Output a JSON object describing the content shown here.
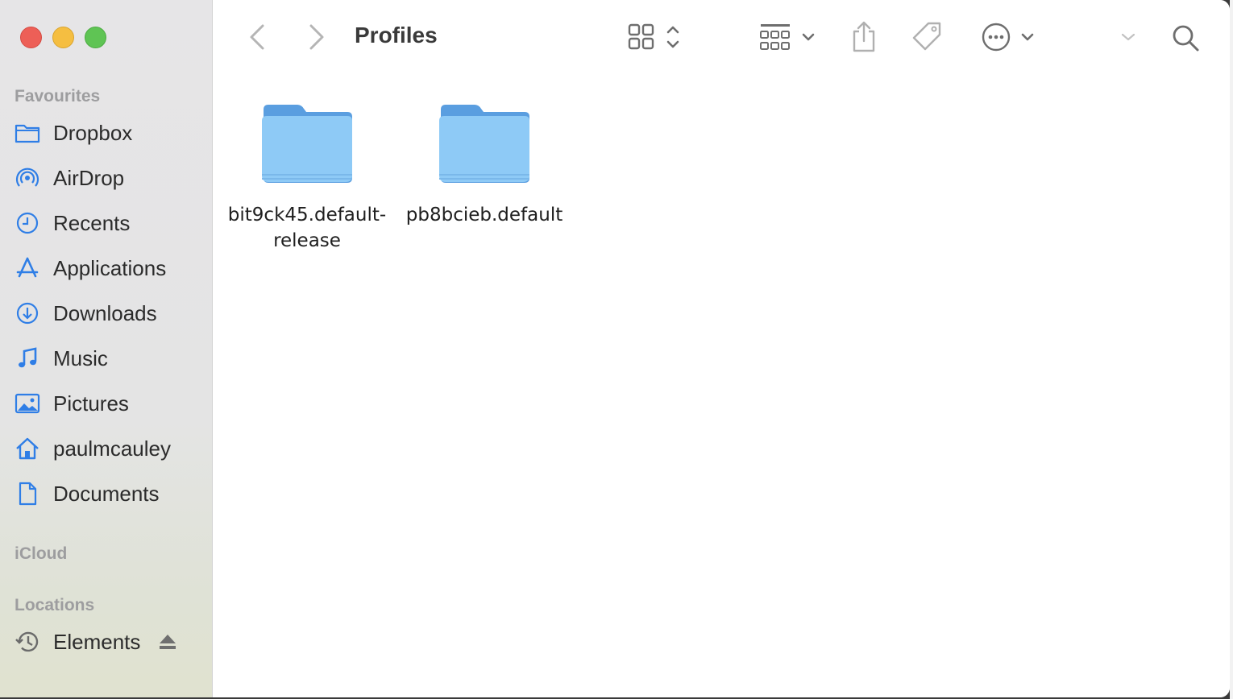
{
  "window": {
    "title": "Profiles"
  },
  "sidebar": {
    "favourites_title": "Favourites",
    "items": [
      {
        "label": "Dropbox",
        "icon": "folder-icon"
      },
      {
        "label": "AirDrop",
        "icon": "airdrop-icon"
      },
      {
        "label": "Recents",
        "icon": "clock-icon"
      },
      {
        "label": "Applications",
        "icon": "applications-icon"
      },
      {
        "label": "Downloads",
        "icon": "download-icon"
      },
      {
        "label": "Music",
        "icon": "music-note-icon"
      },
      {
        "label": "Pictures",
        "icon": "photo-icon"
      },
      {
        "label": "paulmcauley",
        "icon": "home-icon"
      },
      {
        "label": "Documents",
        "icon": "document-icon"
      }
    ],
    "icloud_title": "iCloud",
    "locations_title": "Locations",
    "locations": [
      {
        "label": "Elements",
        "icon": "time-machine-icon"
      }
    ]
  },
  "files": [
    {
      "name_line1": "bit9ck45.default-",
      "name_line2": "release"
    },
    {
      "name_line1": "pb8bcieb.default",
      "name_line2": ""
    }
  ],
  "colors": {
    "accent": "#2f7ee6",
    "folder": "#8ecaf6"
  }
}
